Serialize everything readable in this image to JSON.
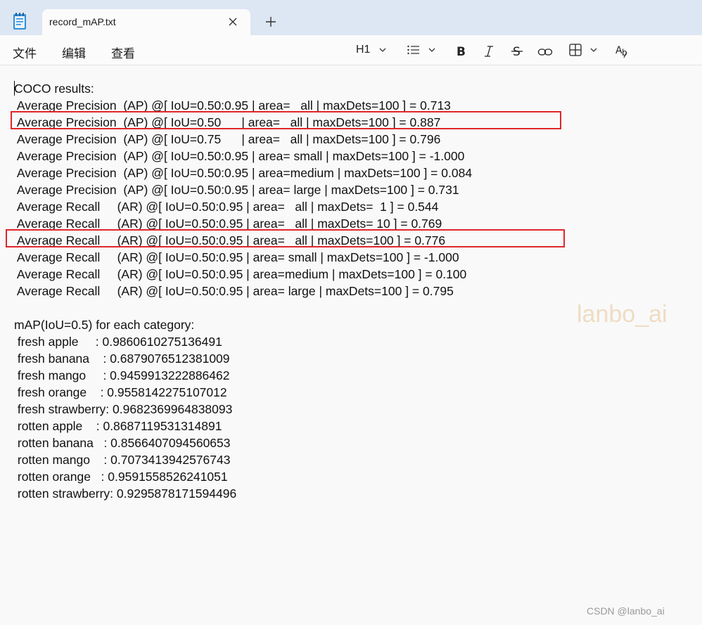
{
  "window": {
    "tab_title": "record_mAP.txt",
    "app_icon": "notepad-icon",
    "close_icon": "close-icon",
    "new_tab_icon": "plus-icon"
  },
  "menu": {
    "file": "文件",
    "edit": "编辑",
    "view": "查看"
  },
  "toolbar": {
    "heading": "H1",
    "list_icon": "bulleted-list-icon",
    "bold_icon": "bold-icon",
    "italic_icon": "italic-icon",
    "strike_icon": "strikethrough-icon",
    "link_icon": "link-icon",
    "table_icon": "table-icon",
    "spell_icon": "spellcheck-icon"
  },
  "document": {
    "lines": [
      "COCO results:",
      " Average Precision  (AP) @[ IoU=0.50:0.95 | area=   all | maxDets=100 ] = 0.713",
      " Average Precision  (AP) @[ IoU=0.50      | area=   all | maxDets=100 ] = 0.887",
      " Average Precision  (AP) @[ IoU=0.75      | area=   all | maxDets=100 ] = 0.796",
      " Average Precision  (AP) @[ IoU=0.50:0.95 | area= small | maxDets=100 ] = -1.000",
      " Average Precision  (AP) @[ IoU=0.50:0.95 | area=medium | maxDets=100 ] = 0.084",
      " Average Precision  (AP) @[ IoU=0.50:0.95 | area= large | maxDets=100 ] = 0.731",
      " Average Recall     (AR) @[ IoU=0.50:0.95 | area=   all | maxDets=  1 ] = 0.544",
      " Average Recall     (AR) @[ IoU=0.50:0.95 | area=   all | maxDets= 10 ] = 0.769",
      " Average Recall     (AR) @[ IoU=0.50:0.95 | area=   all | maxDets=100 ] = 0.776",
      " Average Recall     (AR) @[ IoU=0.50:0.95 | area= small | maxDets=100 ] = -1.000",
      " Average Recall     (AR) @[ IoU=0.50:0.95 | area=medium | maxDets=100 ] = 0.100",
      " Average Recall     (AR) @[ IoU=0.50:0.95 | area= large | maxDets=100 ] = 0.795",
      "",
      "mAP(IoU=0.5) for each category:",
      " fresh apple     : 0.9860610275136491",
      " fresh banana    : 0.6879076512381009",
      " fresh mango     : 0.9459913222886462",
      " fresh orange    : 0.9558142275107012",
      " fresh strawberry: 0.9682369964838093",
      " rotten apple    : 0.8687119531314891",
      " rotten banana   : 0.8566407094560653",
      " rotten mango    : 0.7073413942576743",
      " rotten orange   : 0.9591558526241051",
      " rotten strawberry: 0.9295878171594496"
    ]
  },
  "watermark": "lanbo_ai",
  "credit": "CSDN @lanbo_ai",
  "colors": {
    "highlight": "#e0262b",
    "titlebar": "#dde6f3"
  }
}
